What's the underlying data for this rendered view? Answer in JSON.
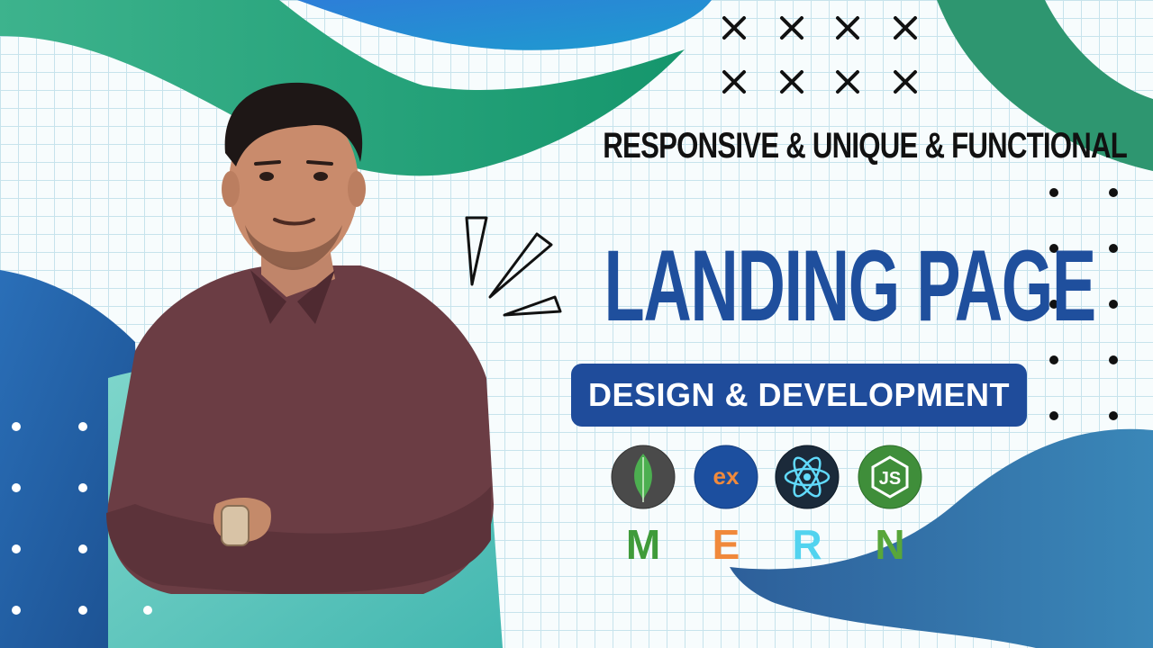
{
  "tagline": "RESPONSIVE & UNIQUE & FUNCTIONAL",
  "headline": "LANDING PAGE",
  "badge_label": "DESIGN & DEVELOPMENT",
  "tech_icons": [
    {
      "name": "mongodb-icon",
      "glyph": "",
      "bg": "#4a4a4a",
      "fg": "#4caf50"
    },
    {
      "name": "express-icon",
      "glyph": "ex",
      "bg": "#1c4f9f",
      "fg": "#f08a3c"
    },
    {
      "name": "react-icon",
      "glyph": "",
      "bg": "#1b2a3a",
      "fg": "#61dafb"
    },
    {
      "name": "nodejs-icon",
      "glyph": "JS",
      "bg": "#3f8e3a",
      "fg": "#ffffff"
    }
  ],
  "stack_letters": [
    {
      "char": "M",
      "color": "#3f9b3a"
    },
    {
      "char": "E",
      "color": "#f0893b"
    },
    {
      "char": "R",
      "color": "#52d3ef"
    },
    {
      "char": "N",
      "color": "#58a63a"
    }
  ],
  "colors": {
    "accent_blue": "#1f4f9d",
    "badge_blue": "#1f4c9b",
    "wave_green": "#2b9a78",
    "wave_blue": "#1f7fc9"
  }
}
